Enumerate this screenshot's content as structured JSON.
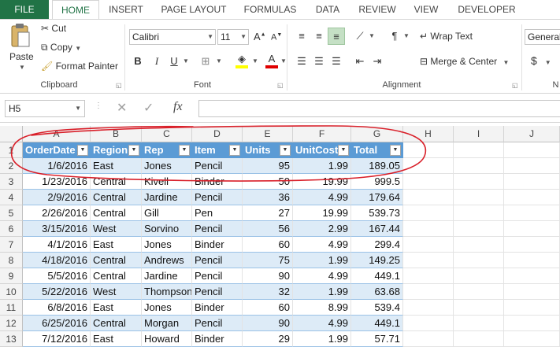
{
  "ribbon_tabs": [
    "FILE",
    "HOME",
    "INSERT",
    "PAGE LAYOUT",
    "FORMULAS",
    "DATA",
    "REVIEW",
    "VIEW",
    "DEVELOPER"
  ],
  "clipboard": {
    "paste": "Paste",
    "cut": "Cut",
    "copy": "Copy",
    "format_painter": "Format Painter",
    "label": "Clipboard"
  },
  "font": {
    "name": "Calibri",
    "size": "11",
    "label": "Font"
  },
  "alignment": {
    "wrap_text": "Wrap Text",
    "merge_center": "Merge & Center",
    "label": "Alignment"
  },
  "number": {
    "format": "General",
    "currency": "$",
    "label": "N"
  },
  "formula_bar": {
    "name_box": "H5",
    "fx": "fx",
    "value": ""
  },
  "columns": [
    "A",
    "B",
    "C",
    "D",
    "E",
    "F",
    "G",
    "H",
    "I",
    "J"
  ],
  "rows": [
    "1",
    "2",
    "3",
    "4",
    "5",
    "6",
    "7",
    "8",
    "9",
    "10",
    "11",
    "12",
    "13"
  ],
  "table": {
    "headers": [
      "OrderDate",
      "Region",
      "Rep",
      "Item",
      "Units",
      "UnitCost",
      "Total"
    ],
    "data": [
      [
        "1/6/2016",
        "East",
        "Jones",
        "Pencil",
        "95",
        "1.99",
        "189.05"
      ],
      [
        "1/23/2016",
        "Central",
        "Kivell",
        "Binder",
        "50",
        "19.99",
        "999.5"
      ],
      [
        "2/9/2016",
        "Central",
        "Jardine",
        "Pencil",
        "36",
        "4.99",
        "179.64"
      ],
      [
        "2/26/2016",
        "Central",
        "Gill",
        "Pen",
        "27",
        "19.99",
        "539.73"
      ],
      [
        "3/15/2016",
        "West",
        "Sorvino",
        "Pencil",
        "56",
        "2.99",
        "167.44"
      ],
      [
        "4/1/2016",
        "East",
        "Jones",
        "Binder",
        "60",
        "4.99",
        "299.4"
      ],
      [
        "4/18/2016",
        "Central",
        "Andrews",
        "Pencil",
        "75",
        "1.99",
        "149.25"
      ],
      [
        "5/5/2016",
        "Central",
        "Jardine",
        "Pencil",
        "90",
        "4.99",
        "449.1"
      ],
      [
        "5/22/2016",
        "West",
        "Thompson",
        "Pencil",
        "32",
        "1.99",
        "63.68"
      ],
      [
        "6/8/2016",
        "East",
        "Jones",
        "Binder",
        "60",
        "8.99",
        "539.4"
      ],
      [
        "6/25/2016",
        "Central",
        "Morgan",
        "Pencil",
        "90",
        "4.99",
        "449.1"
      ],
      [
        "7/12/2016",
        "East",
        "Howard",
        "Binder",
        "29",
        "1.99",
        "57.71"
      ]
    ]
  },
  "colors": {
    "file_tab": "#217346",
    "table_header": "#5b9bd5",
    "band": "#ddebf7",
    "annotation": "#d9202a"
  }
}
